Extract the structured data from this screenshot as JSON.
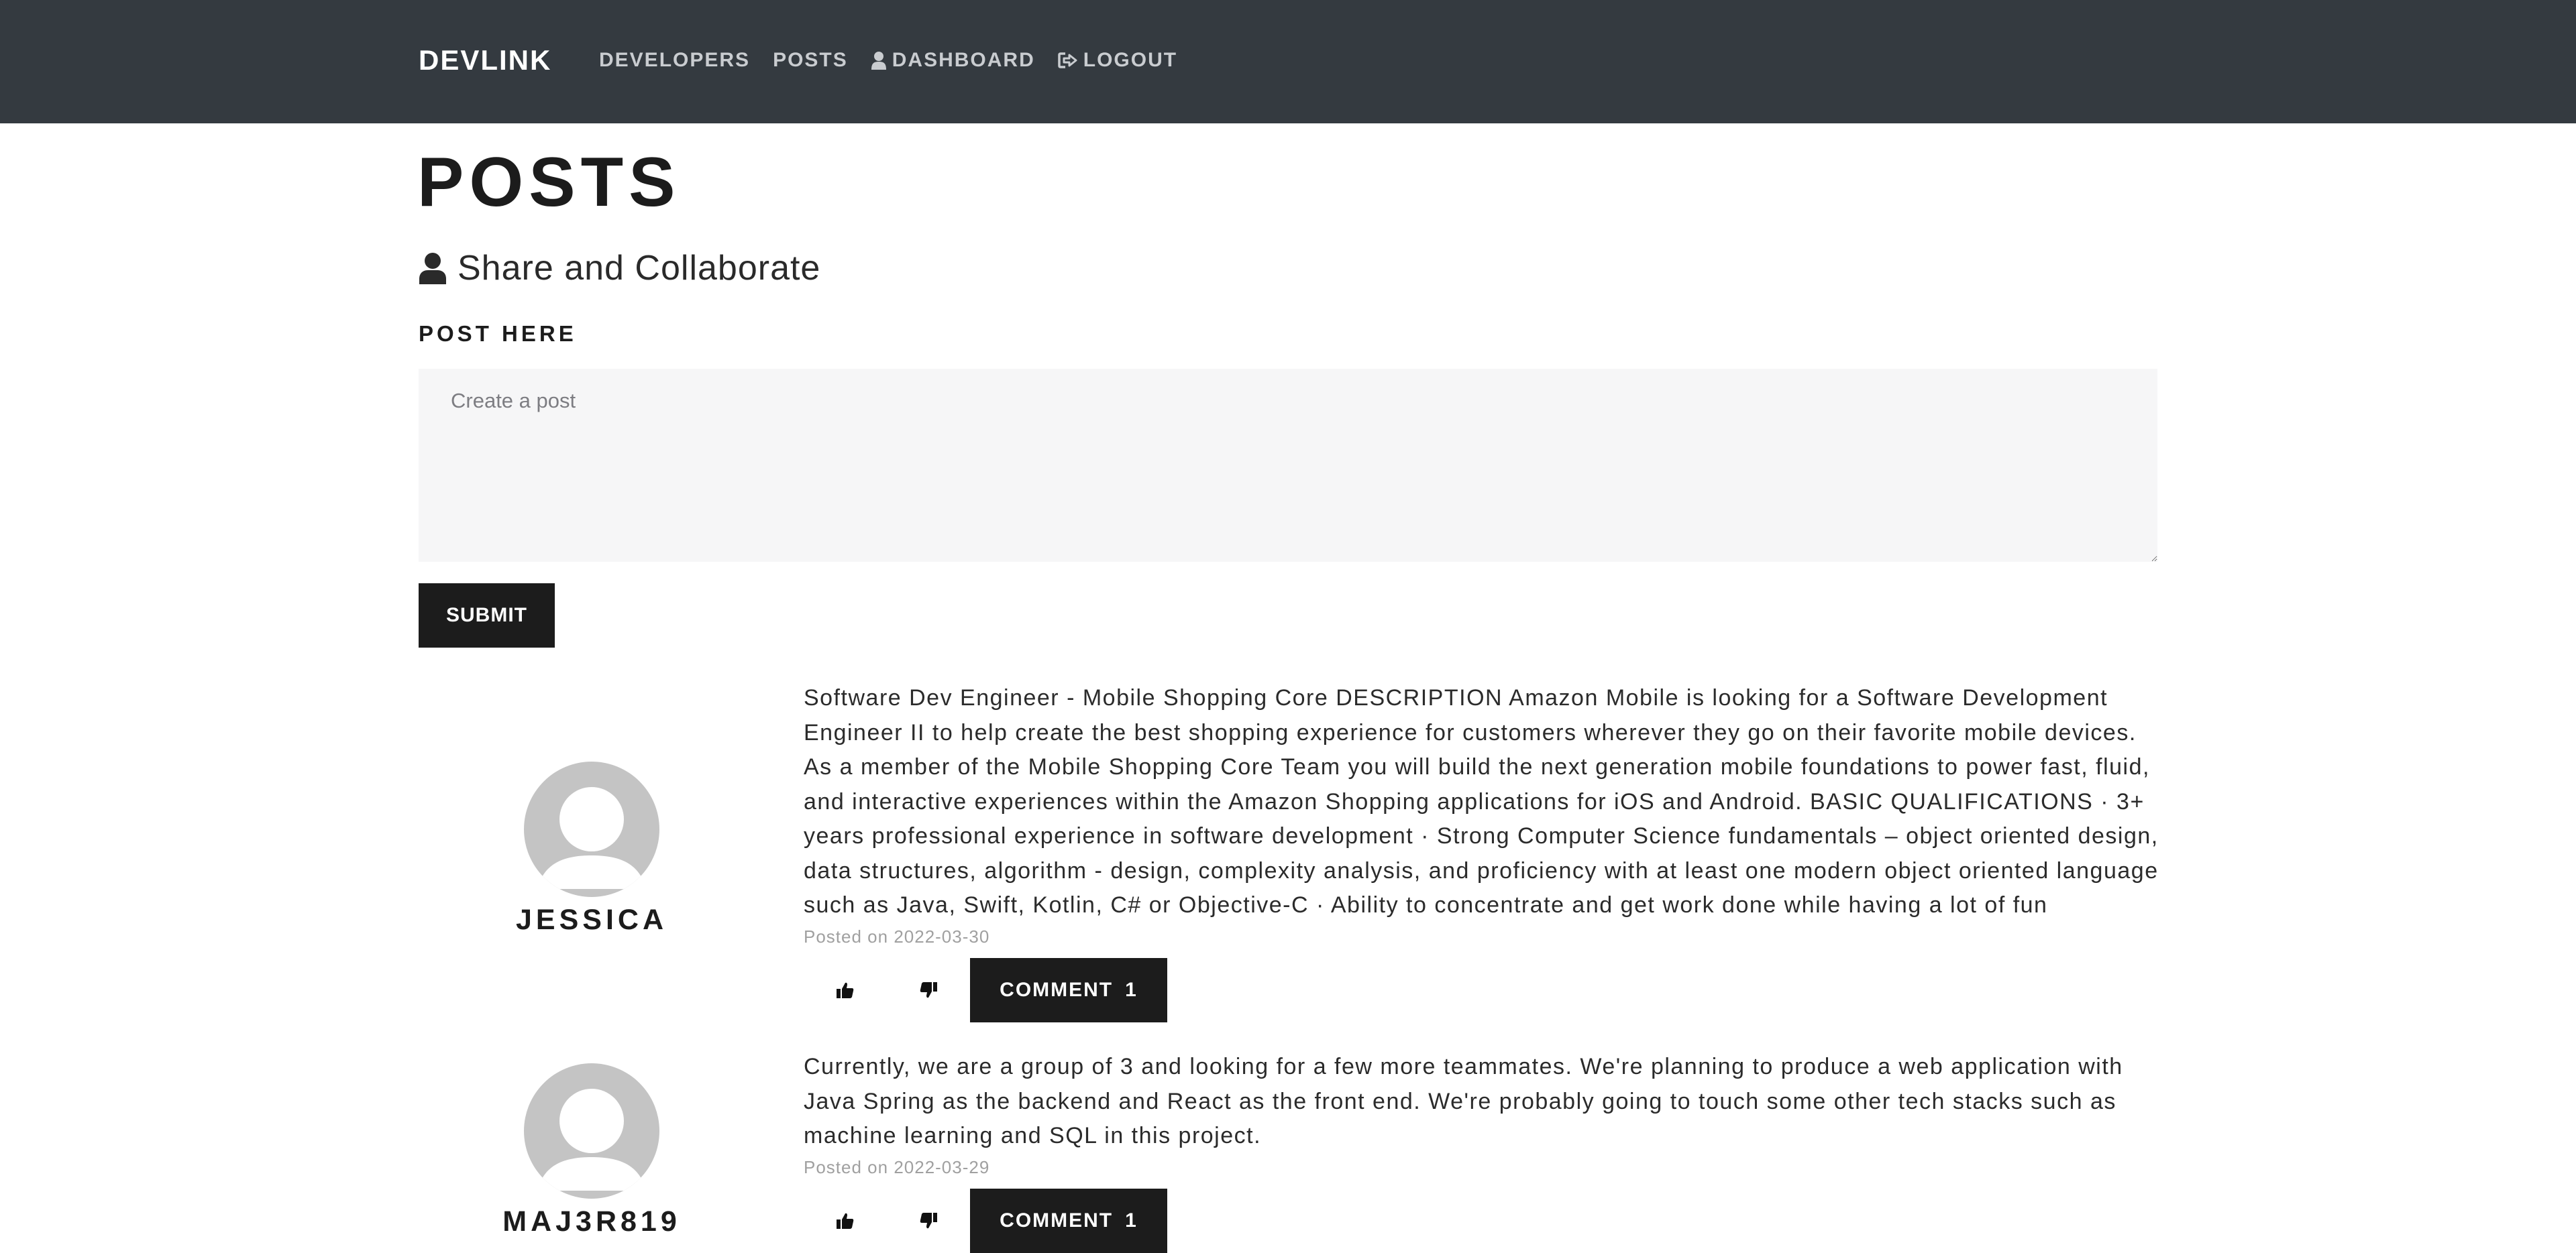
{
  "navbar": {
    "brand": "DEVLINK",
    "links": [
      {
        "label": "DEVELOPERS",
        "icon": ""
      },
      {
        "label": "POSTS",
        "icon": ""
      },
      {
        "label": "DASHBOARD",
        "icon": "user-icon"
      },
      {
        "label": "LOGOUT",
        "icon": "sign-out-icon"
      }
    ]
  },
  "page": {
    "title": "POSTS",
    "subtitle": "Share and Collaborate",
    "subtitle_icon": "user-icon"
  },
  "form": {
    "label": "POST HERE",
    "placeholder": "Create a post",
    "value": "",
    "submit_label": "SUBMIT"
  },
  "posts": [
    {
      "author": "JESSICA",
      "text": "Software Dev Engineer - Mobile Shopping Core DESCRIPTION Amazon Mobile is looking for a Software Development Engineer II to help create the best shopping experience for customers wherever they go on their favorite mobile devices. As a member of the Mobile Shopping Core Team you will build the next generation mobile foundations to power fast, fluid, and interactive experiences within the Amazon Shopping applications for iOS and Android. BASIC QUALIFICATIONS · 3+ years professional experience in software development · Strong Computer Science fundamentals – object oriented design, data structures, algorithm - design, complexity analysis, and proficiency with at least one modern object oriented language such as Java, Swift, Kotlin, C# or Objective-C · Ability to concentrate and get work done while having a lot of fun",
      "date": "Posted on 2022-03-30",
      "comment_label": "COMMENT",
      "comment_count": "1"
    },
    {
      "author": "MAJ3R819",
      "text": "Currently, we are a group of 3 and looking for a few more teammates. We're planning to produce a web application with Java Spring as the backend and React as the front end. We're probably going to touch some other tech stacks such as machine learning and SQL in this project.",
      "date": "Posted on 2022-03-29",
      "comment_label": "COMMENT",
      "comment_count": "1"
    }
  ],
  "colors": {
    "navbar_bg": "#343a40",
    "button_bg": "#1c1c1c",
    "avatar_bg": "#c4c4c4"
  }
}
